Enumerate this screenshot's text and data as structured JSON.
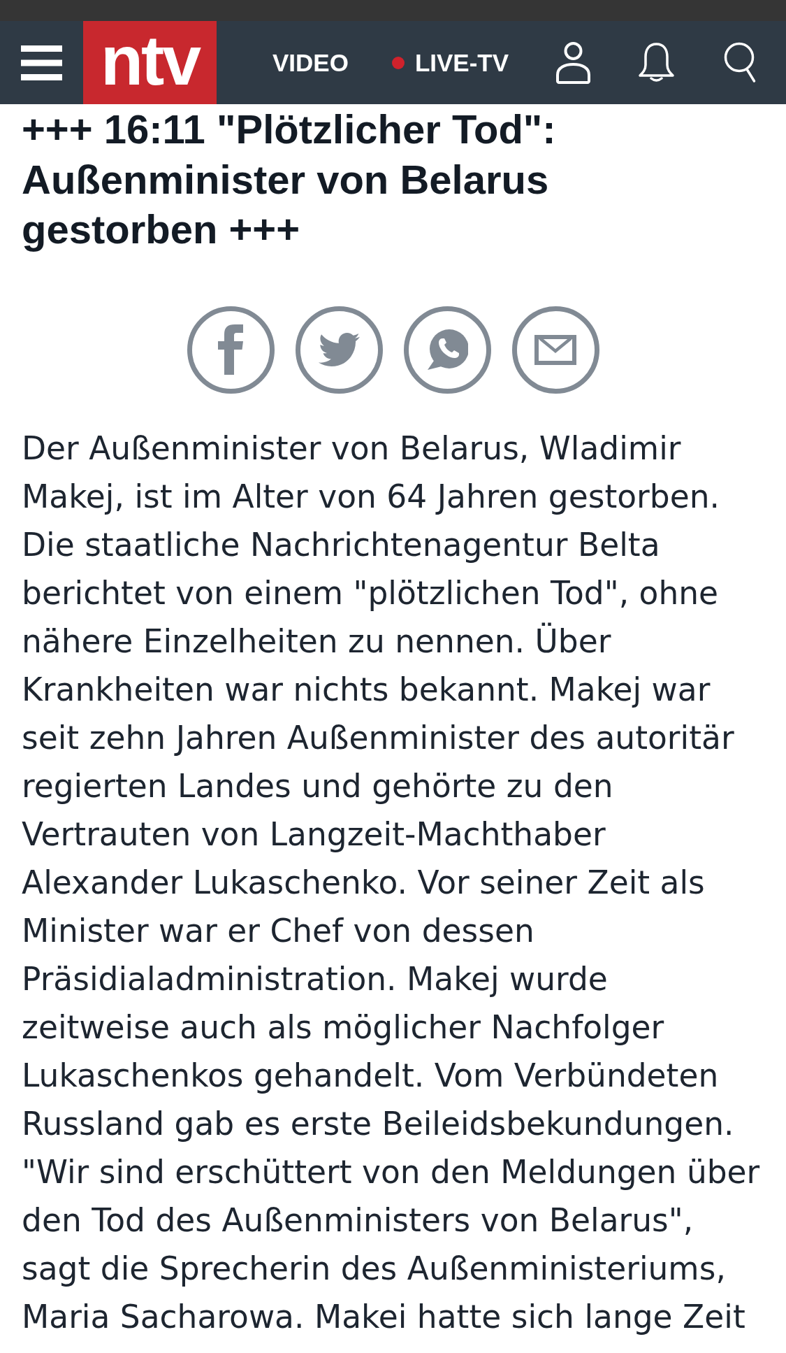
{
  "header": {
    "logo": "ntv",
    "nav": [
      {
        "label": "VIDEO",
        "live": false
      },
      {
        "label": "LIVE-TV",
        "live": true
      }
    ]
  },
  "article": {
    "headline": "+++ 16:11 \"Plötzlicher Tod\": Außenminister von Belarus gestorben +++",
    "share_buttons": [
      {
        "kind": "facebook"
      },
      {
        "kind": "twitter"
      },
      {
        "kind": "whatsapp"
      },
      {
        "kind": "email"
      }
    ],
    "body": "Der Außenminister von Belarus, Wladimir Makej, ist im Alter von 64 Jahren gestorben. Die staatliche Nachrichtenagentur Belta berichtet von einem \"plötzlichen Tod\", ohne nähere Einzelheiten zu nennen. Über Krankheiten war nichts bekannt. Makej war seit zehn Jahren Außenminister des autoritär regierten Landes und gehörte zu den Vertrauten von Langzeit-Machthaber Alexander Lukaschenko. Vor seiner Zeit als Minister war er Chef von dessen Präsidialadministration. Makej wurde zeitweise auch als möglicher Nachfolger Lukaschenkos gehandelt. Vom Verbündeten Russland gab es erste Beileidsbekundungen. \"Wir sind erschüttert von den Meldungen über den Tod des Außenministers von Belarus\", sagt die Sprecherin des Außenministeriums, Maria Sacharowa. Makei hatte sich lange Zeit"
  }
}
